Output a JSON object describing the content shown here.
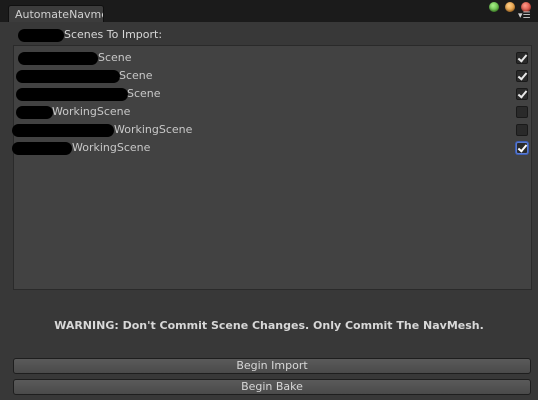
{
  "window": {
    "tab_title": "AutomateNavme",
    "menu_icon": "tab-menu-icon"
  },
  "header": {
    "label": "Scenes To Import:"
  },
  "scenes": [
    {
      "name": "Scene",
      "checked": true
    },
    {
      "name": "Scene",
      "checked": true
    },
    {
      "name": "Scene",
      "checked": true
    },
    {
      "name": "WorkingScene",
      "checked": false
    },
    {
      "name": "WorkingScene",
      "checked": false
    },
    {
      "name": "WorkingScene",
      "checked": true,
      "focused": true
    }
  ],
  "warning": "WARNING: Don't Commit Scene Changes. Only Commit The NavMesh.",
  "buttons": {
    "import": "Begin Import",
    "bake": "Begin Bake"
  }
}
